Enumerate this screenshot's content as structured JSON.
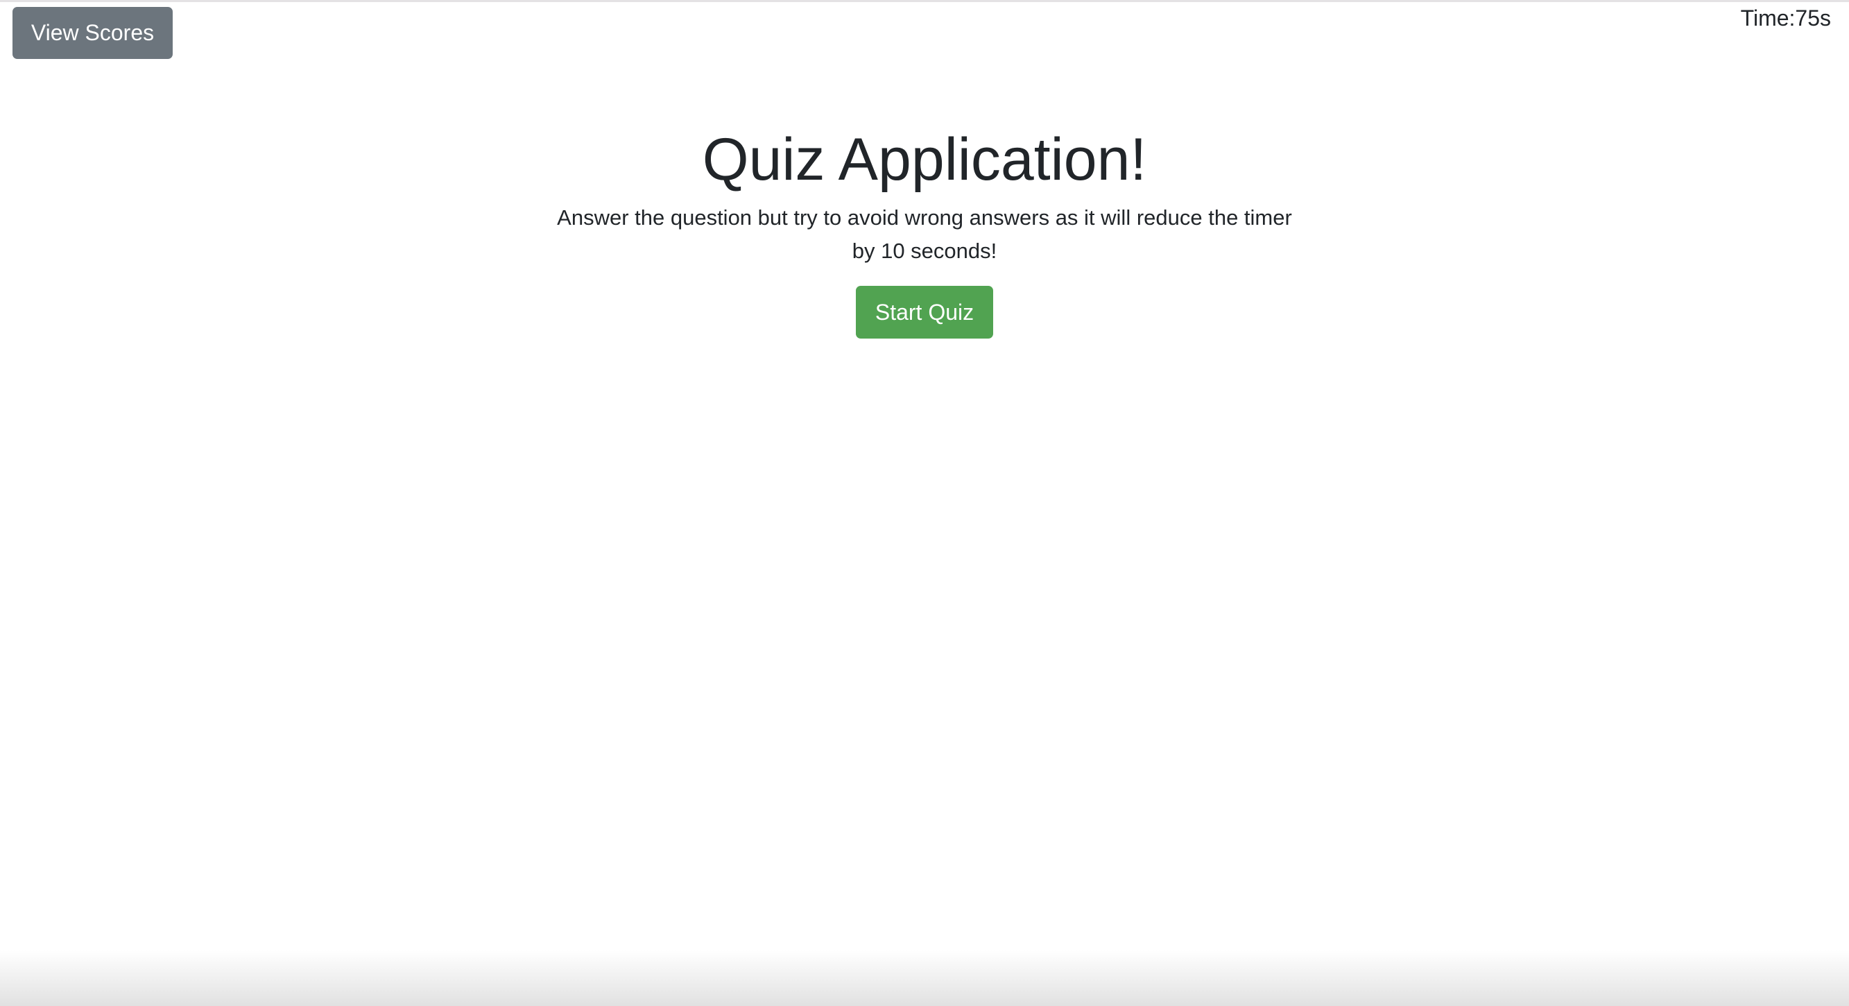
{
  "header": {
    "view_scores_label": "View Scores",
    "timer_text": "Time:75s"
  },
  "main": {
    "title": "Quiz Application!",
    "description": "Answer the question but try to avoid wrong answers as it will reduce the timer by 10 seconds!",
    "start_label": "Start Quiz"
  },
  "colors": {
    "view_scores_bg": "#6c757d",
    "start_bg": "#51a351",
    "text": "#212529"
  }
}
